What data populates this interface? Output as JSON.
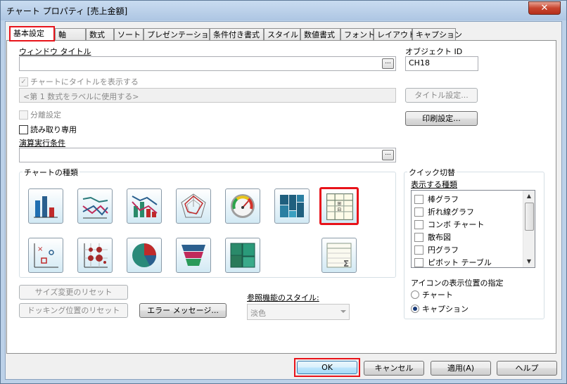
{
  "window": {
    "title": "チャート プロパティ [売上金額]",
    "close_label": "✕"
  },
  "tabs": [
    "基本設定",
    "軸",
    "数式",
    "ソート",
    "プレゼンテーション",
    "条件付き書式",
    "スタイル",
    "数値書式",
    "フォント",
    "レイアウト",
    "キャプション"
  ],
  "general": {
    "window_title_label": "ウィンドウ タイトル",
    "window_title_value": "",
    "object_id_label": "オブジェクト ID",
    "object_id_value": "CH18",
    "show_title_label": "チャートにタイトルを表示する",
    "title_placeholder": "<第 1 数式をラベルに使用する>",
    "title_settings_button": "タイトル設定...",
    "print_settings_button": "印刷設定...",
    "detach_label": "分離設定",
    "readonly_label": "読み取り専用",
    "calc_condition_label": "演算実行条件",
    "calc_condition_value": "",
    "ellipsis": "..."
  },
  "chart_types": {
    "label": "チャートの種類",
    "icons": [
      "bar-chart-icon",
      "line-chart-icon",
      "combo-chart-icon",
      "radar-chart-icon",
      "gauge-chart-icon",
      "mekko-chart-icon",
      "pivot-table-icon",
      "scatter-chart-icon",
      "grid-chart-icon",
      "pie-chart-icon",
      "funnel-chart-icon",
      "block-chart-icon",
      "straight-table-icon"
    ],
    "selected": "pivot-table-icon"
  },
  "quick_switch": {
    "label": "クイック切替",
    "shown_types_label": "表示する種類",
    "items": [
      "棒グラフ",
      "折れ線グラフ",
      "コンボ チャート",
      "散布図",
      "円グラフ",
      "ピボット テーブル"
    ],
    "icon_position_label": "アイコンの表示位置の指定",
    "radio_options": [
      "チャート",
      "キャプション"
    ],
    "radio_selected": "キャプション"
  },
  "bottom": {
    "reset_size_button": "サイズ変更のリセット",
    "reset_docking_button": "ドッキング位置のリセット",
    "error_messages_button": "エラー メッセージ...",
    "reference_style_label": "参照機能のスタイル:",
    "reference_style_value": "淡色"
  },
  "footer": {
    "ok": "OK",
    "cancel": "キャンセル",
    "apply": "適用(A)",
    "help": "ヘルプ"
  },
  "colors": {
    "accent_red": "#e8131a",
    "titlebar": "#bcd1e8"
  }
}
